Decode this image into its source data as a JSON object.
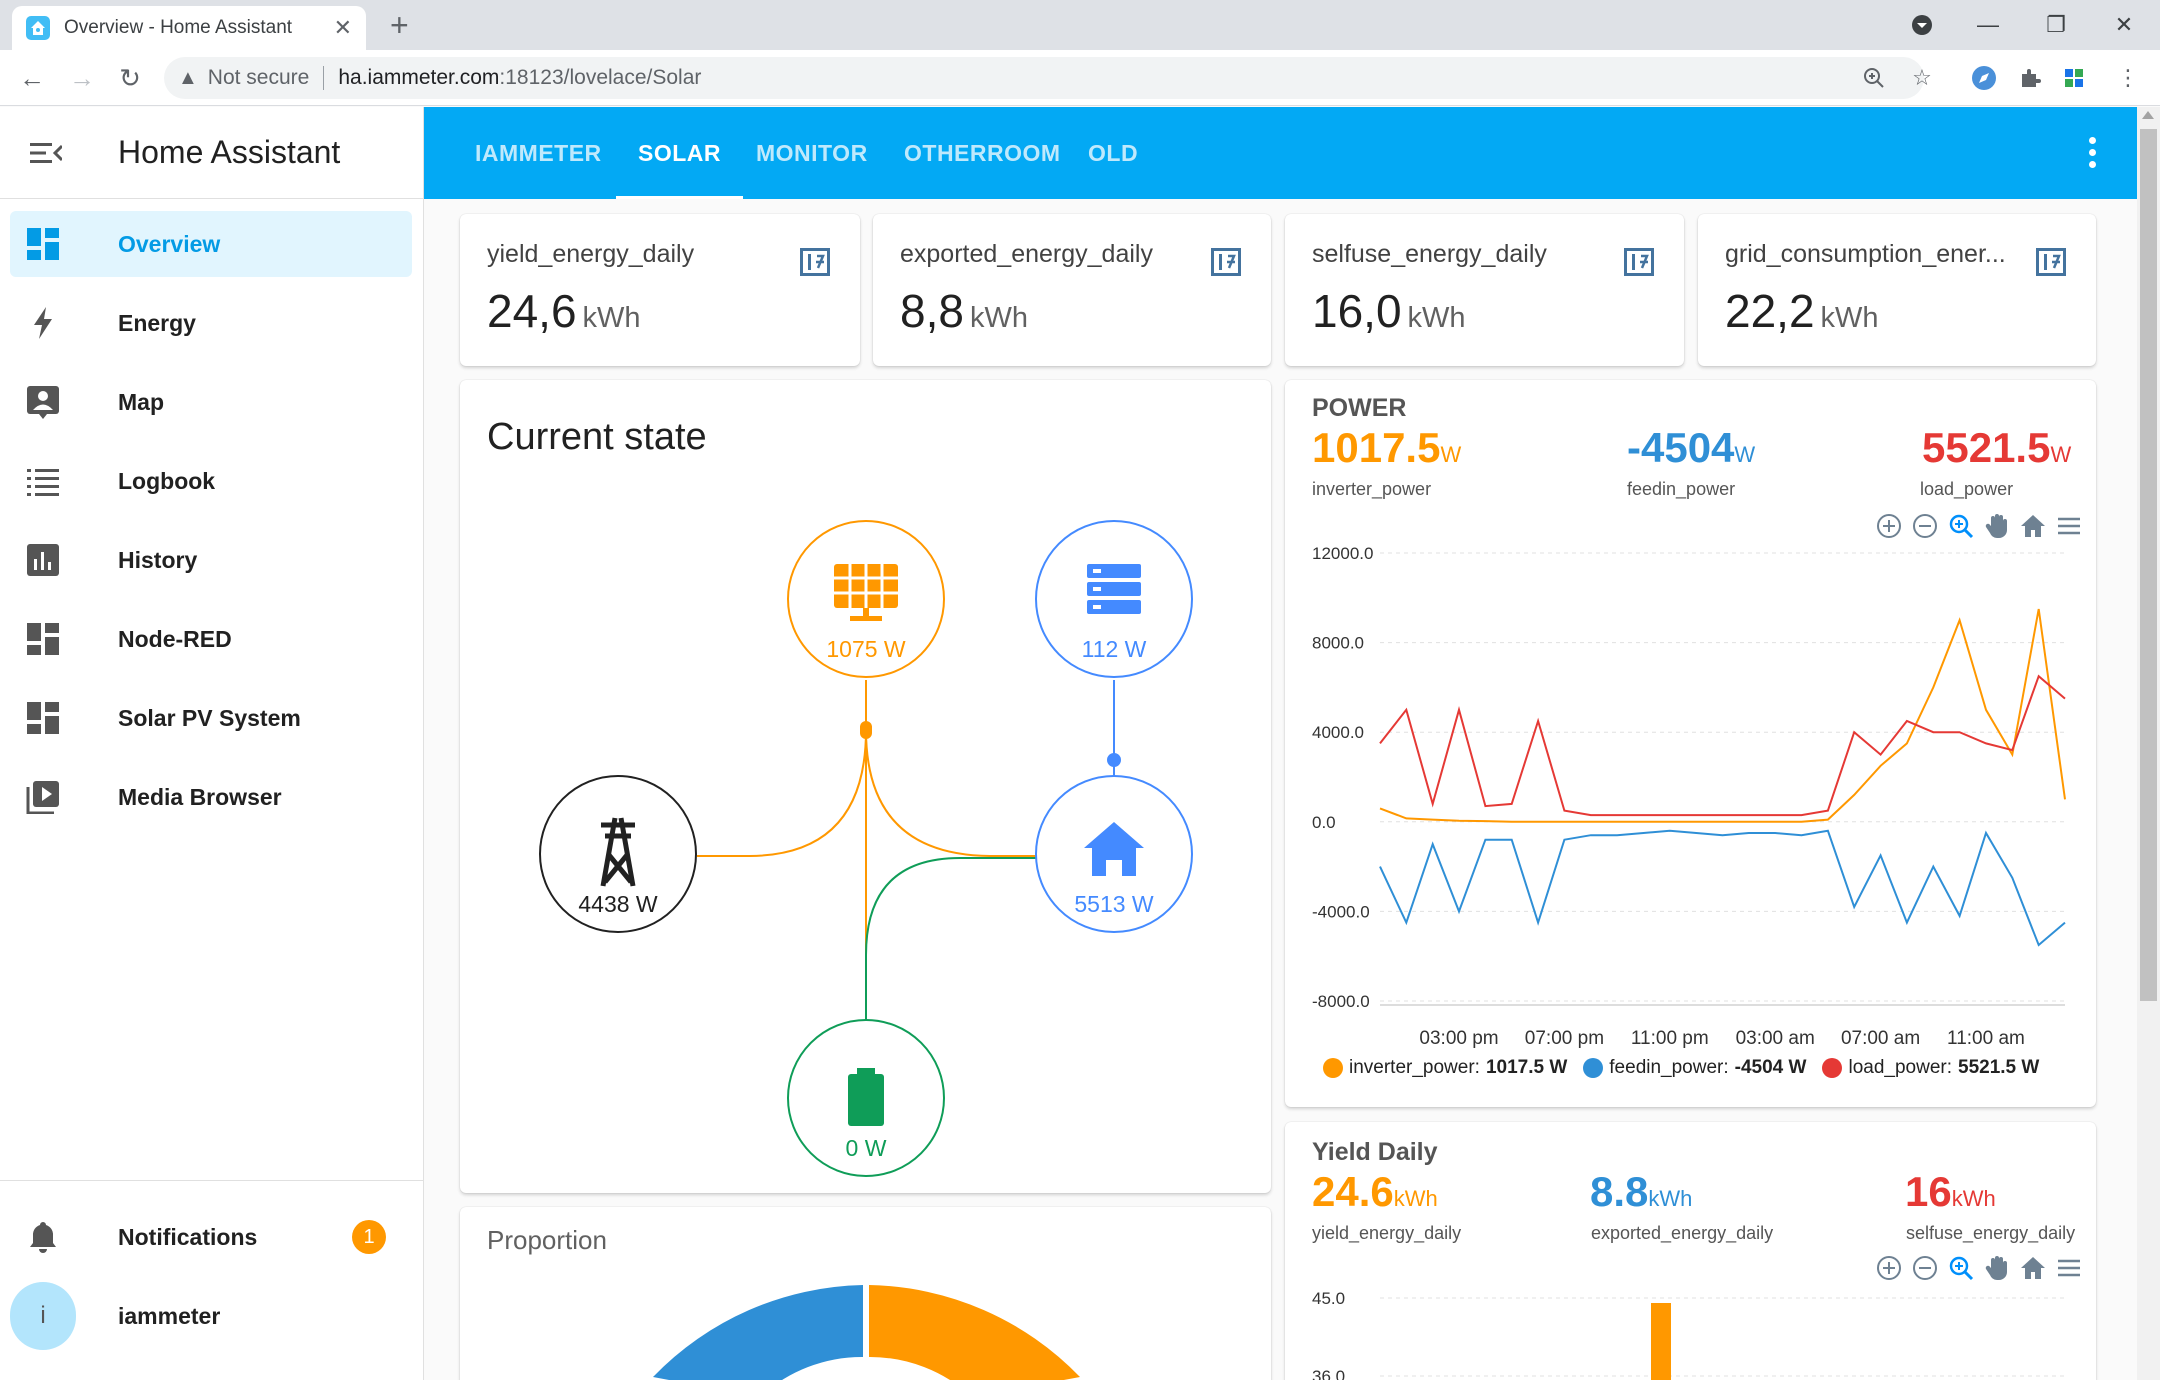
{
  "browser": {
    "tab_title": "Overview - Home Assistant",
    "url_warning": "Not secure",
    "url_host": "ha.iammeter.com",
    "url_path": ":18123/lovelace/Solar"
  },
  "sidebar": {
    "title": "Home Assistant",
    "items": [
      {
        "label": "Overview",
        "icon": "dashboard-icon"
      },
      {
        "label": "Energy",
        "icon": "lightning-icon"
      },
      {
        "label": "Map",
        "icon": "map-account-icon"
      },
      {
        "label": "Logbook",
        "icon": "list-icon"
      },
      {
        "label": "History",
        "icon": "chart-box-icon"
      },
      {
        "label": "Node-RED",
        "icon": "dashboard-icon"
      },
      {
        "label": "Solar PV System",
        "icon": "dashboard-icon"
      },
      {
        "label": "Media Browser",
        "icon": "play-box-icon"
      }
    ],
    "notifications_label": "Notifications",
    "notifications_count": "1",
    "user_initial": "i",
    "user_name": "iammeter"
  },
  "appbar": {
    "tabs": [
      "IAMMETER",
      "SOLAR",
      "MONITOR",
      "OTHERROOM",
      "OLD"
    ],
    "active_tab": "SOLAR"
  },
  "stats": [
    {
      "name": "yield_energy_daily",
      "value": "24,6",
      "unit": "kWh"
    },
    {
      "name": "exported_energy_daily",
      "value": "8,8",
      "unit": "kWh"
    },
    {
      "name": "selfuse_energy_daily",
      "value": "16,0",
      "unit": "kWh"
    },
    {
      "name": "grid_consumption_ener...",
      "value": "22,2",
      "unit": "kWh"
    }
  ],
  "current_state": {
    "title": "Current state",
    "solar": "1075 W",
    "server": "112 W",
    "grid": "4438 W",
    "home": "5513 W",
    "battery": "0 W",
    "colors": {
      "solar": "#ff9800",
      "grid": "#212121",
      "home": "#448aff",
      "battery": "#0f9d58"
    }
  },
  "proportion": {
    "title": "Proportion"
  },
  "power": {
    "header": "POWER",
    "metrics": [
      {
        "value": "1017.5",
        "unit": "W",
        "name": "inverter_power",
        "color": "#ff9800"
      },
      {
        "value": "-4504",
        "unit": "W",
        "name": "feedin_power",
        "color": "#2f8fd6"
      },
      {
        "value": "5521.5",
        "unit": "W",
        "name": "load_power",
        "color": "#e53935"
      }
    ],
    "legend": [
      {
        "label": "inverter_power:",
        "value": "1017.5 W"
      },
      {
        "label": "feedin_power:",
        "value": "-4504 W"
      },
      {
        "label": "load_power:",
        "value": "5521.5 W"
      }
    ],
    "chart_data": {
      "type": "line",
      "ylim": [
        -8000,
        12000
      ],
      "yticks": [
        "12000.0",
        "8000.0",
        "4000.0",
        "0.0",
        "-4000.0",
        "-8000.0"
      ],
      "xticks": [
        "03:00 pm",
        "07:00 pm",
        "11:00 pm",
        "03:00 am",
        "07:00 am",
        "11:00 am"
      ],
      "x_hours": [
        12,
        13,
        14,
        15,
        16,
        17,
        18,
        19,
        20,
        21,
        22,
        23,
        24,
        25,
        26,
        27,
        28,
        29,
        30,
        31,
        32,
        33,
        34,
        35,
        36,
        37,
        38
      ],
      "series": [
        {
          "name": "inverter_power",
          "color": "#ff9800",
          "values": [
            600,
            150,
            100,
            50,
            30,
            0,
            0,
            0,
            0,
            0,
            0,
            0,
            0,
            0,
            0,
            0,
            0,
            100,
            1200,
            2500,
            3500,
            6000,
            9000,
            5000,
            3000,
            9500,
            1000
          ]
        },
        {
          "name": "feedin_power",
          "color": "#2f8fd6",
          "values": [
            -2000,
            -4500,
            -1000,
            -4000,
            -800,
            -800,
            -4500,
            -800,
            -600,
            -600,
            -500,
            -400,
            -500,
            -600,
            -500,
            -500,
            -600,
            -400,
            -3800,
            -1500,
            -4500,
            -2000,
            -4200,
            -500,
            -2500,
            -5500,
            -4500
          ]
        },
        {
          "name": "load_power",
          "color": "#e53935",
          "values": [
            3500,
            5000,
            800,
            5000,
            700,
            800,
            4500,
            500,
            300,
            300,
            300,
            300,
            300,
            300,
            300,
            300,
            300,
            500,
            4000,
            3000,
            4500,
            4000,
            4000,
            3500,
            3200,
            6500,
            5500
          ]
        }
      ]
    }
  },
  "yield_daily": {
    "header": "Yield Daily",
    "metrics": [
      {
        "value": "24.6",
        "unit": "kWh",
        "name": "yield_energy_daily",
        "color": "#ff9800"
      },
      {
        "value": "8.8",
        "unit": "kWh",
        "name": "exported_energy_daily",
        "color": "#2f8fd6"
      },
      {
        "value": "16",
        "unit": "kWh",
        "name": "selfuse_energy_daily",
        "color": "#e53935"
      }
    ],
    "yticks": [
      "45.0",
      "36.0"
    ]
  }
}
